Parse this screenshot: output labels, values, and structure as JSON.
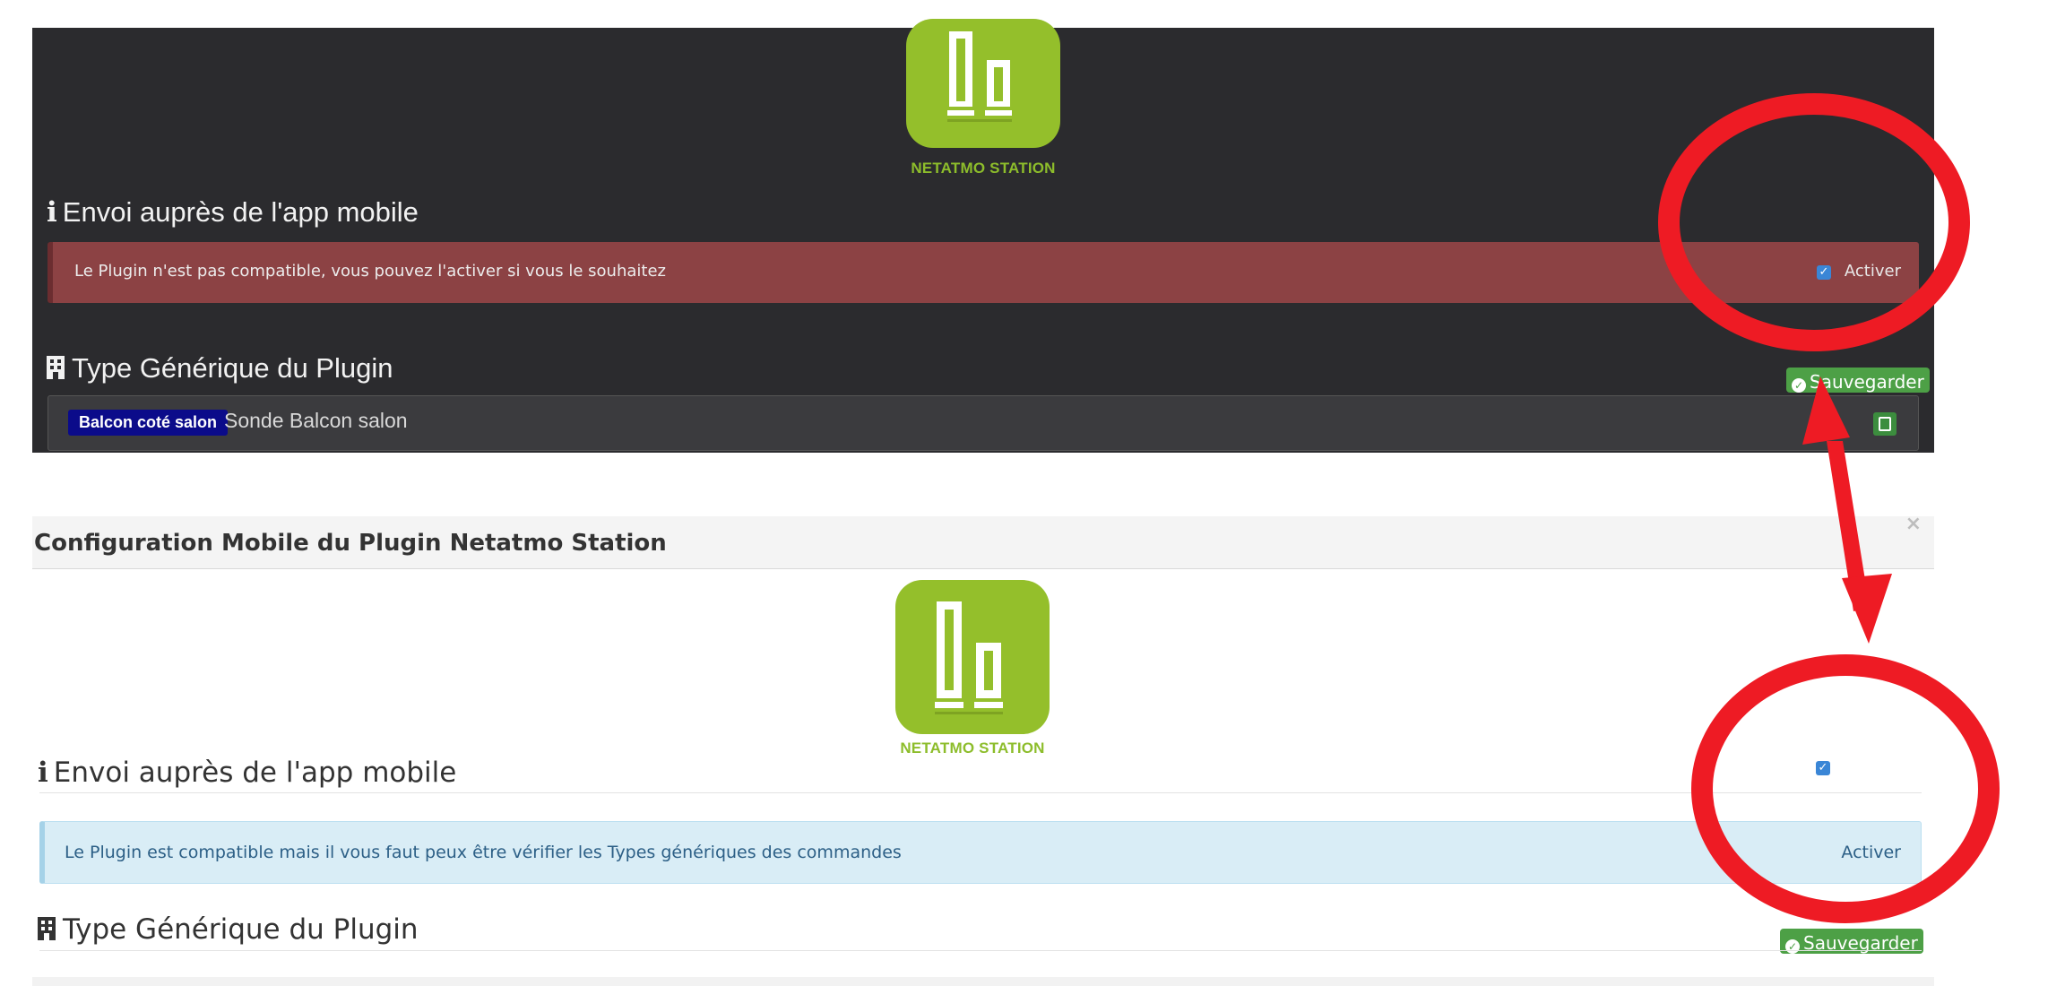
{
  "top_panel": {
    "logo_text": "NETATMO STATION",
    "heading_mobile": "Envoi auprès de l'app mobile",
    "alert_message": "Le Plugin n'est pas compatible, vous pouvez l'activer si vous le souhaitez",
    "activer_label": "Activer",
    "heading_generic": "Type Générique du Plugin",
    "save_label": "Sauvegarder",
    "command_badge": "Balcon coté salon",
    "command_name": "Sonde Balcon salon"
  },
  "bottom_panel": {
    "modal_title": "Configuration Mobile du Plugin Netatmo Station",
    "close_symbol": "×",
    "logo_text": "NETATMO STATION",
    "heading_mobile": "Envoi auprès de l'app mobile",
    "alert_message": "Le Plugin est compatible mais il vous faut peux être vérifier les Types génériques des commandes",
    "activer_label": "Activer",
    "heading_generic": "Type Générique du Plugin",
    "save_label": "Sauvegarder"
  },
  "icons": {
    "info": "info-icon",
    "building": "building-icon",
    "check_circle": "check-circle-icon",
    "floppy": "floppy-icon"
  },
  "colors": {
    "dark_bg": "#2b2b2e",
    "logo_green": "#94bf2b",
    "danger_alert": "#8c4244",
    "info_alert": "#d9edf6",
    "success_button": "#4da046",
    "badge_blue": "#0b0b8a",
    "annotation_red": "#ee1b24"
  }
}
